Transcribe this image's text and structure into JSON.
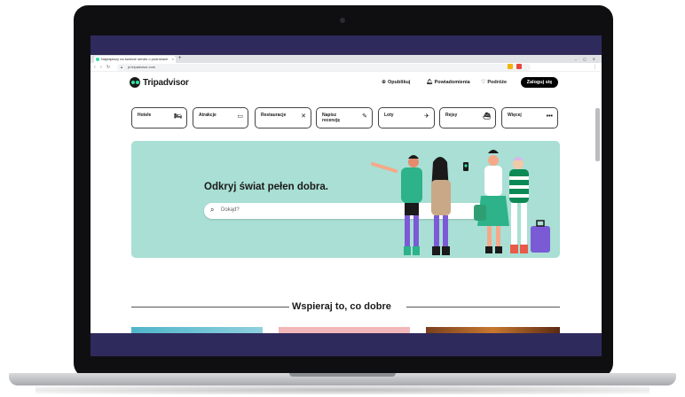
{
  "browser": {
    "tab_title": "Największy na świecie serwis o podróżach",
    "tab_close": "×",
    "new_tab": "+",
    "window_controls": "‒ ◻ ✕",
    "url": "pl.tripadvisor.com"
  },
  "header": {
    "logo_text": "Tripadvisor",
    "publish_label": "Opublikuj",
    "notifications_label": "Powiadomienia",
    "trips_label": "Podróże",
    "login_label": "Zaloguj się"
  },
  "categories": [
    {
      "label": "Hotele",
      "icon": "bed-icon"
    },
    {
      "label": "Atrakcje",
      "icon": "ticket-icon"
    },
    {
      "label": "Restauracje",
      "icon": "cutlery-icon"
    },
    {
      "label": "Napisz recenzję",
      "icon": "edit-icon"
    },
    {
      "label": "Loty",
      "icon": "plane-icon"
    },
    {
      "label": "Rejsy",
      "icon": "ship-icon"
    },
    {
      "label": "Więcej",
      "icon": "more-icon"
    }
  ],
  "hero": {
    "title": "Odkryj świat pełen dobra.",
    "search_placeholder": "Dokąd?"
  },
  "section": {
    "title": "Wspieraj to, co dobre"
  },
  "colors": {
    "brand_green": "#34e0a1",
    "hero_bg": "#a9dfd4",
    "frame_purple": "#2f2a5c"
  }
}
